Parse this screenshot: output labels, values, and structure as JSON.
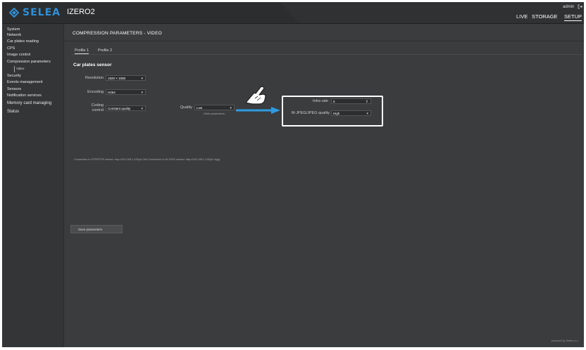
{
  "header": {
    "logo_text": "SELEA",
    "device_name": "IZERO2",
    "nav": {
      "live": "LIVE",
      "storage": "STORAGE",
      "setup": "SETUP"
    },
    "user": "admin",
    "logout_icon": "logout-icon",
    "brand_color": "#2f8fd6"
  },
  "sidebar": {
    "items": {
      "system": "System",
      "network": "Network",
      "car_plates_reading": "Car plates reading",
      "cps": "CPS",
      "image_control": "Image control",
      "compression_parameters": "Compression parameters",
      "video": "Video",
      "security": "Security",
      "events_management": "Events management",
      "sensors": "Sensors",
      "notification_services": "Notification services",
      "memory_card_managing": "Memory card managing",
      "status": "Status"
    }
  },
  "main": {
    "page_title": "COMPRESSION PARAMETERS - VIDEO",
    "tabs": {
      "profile1": "Profile 1",
      "profile2": "Profile 2"
    },
    "section_title": "Car plates sensor",
    "resolution": {
      "label": "Resolution",
      "value": "1920 × 1080"
    },
    "encoding": {
      "label": "Encoding",
      "value": "H264"
    },
    "coding_control": {
      "label_line1": "Coding",
      "label_line2": "control",
      "value": "Constant quality"
    },
    "quality": {
      "label": "Quality",
      "value": "Low",
      "other_params": "Other parameters..."
    },
    "intra_rate": {
      "label": "Intra rate",
      "value": "5"
    },
    "mjpeg_quality": {
      "label": "M-JPEG/JPEG quality",
      "value": "High"
    },
    "connection_note": "Connection to RTP/RTSP stream: rtsp://192.168.1.135/p1.264   Connection to M-JPEG stream: http://192.168.1.135/p1.mjpg",
    "save_button": "Save parameters",
    "powered_by": "powered by Selea s.r.l."
  }
}
